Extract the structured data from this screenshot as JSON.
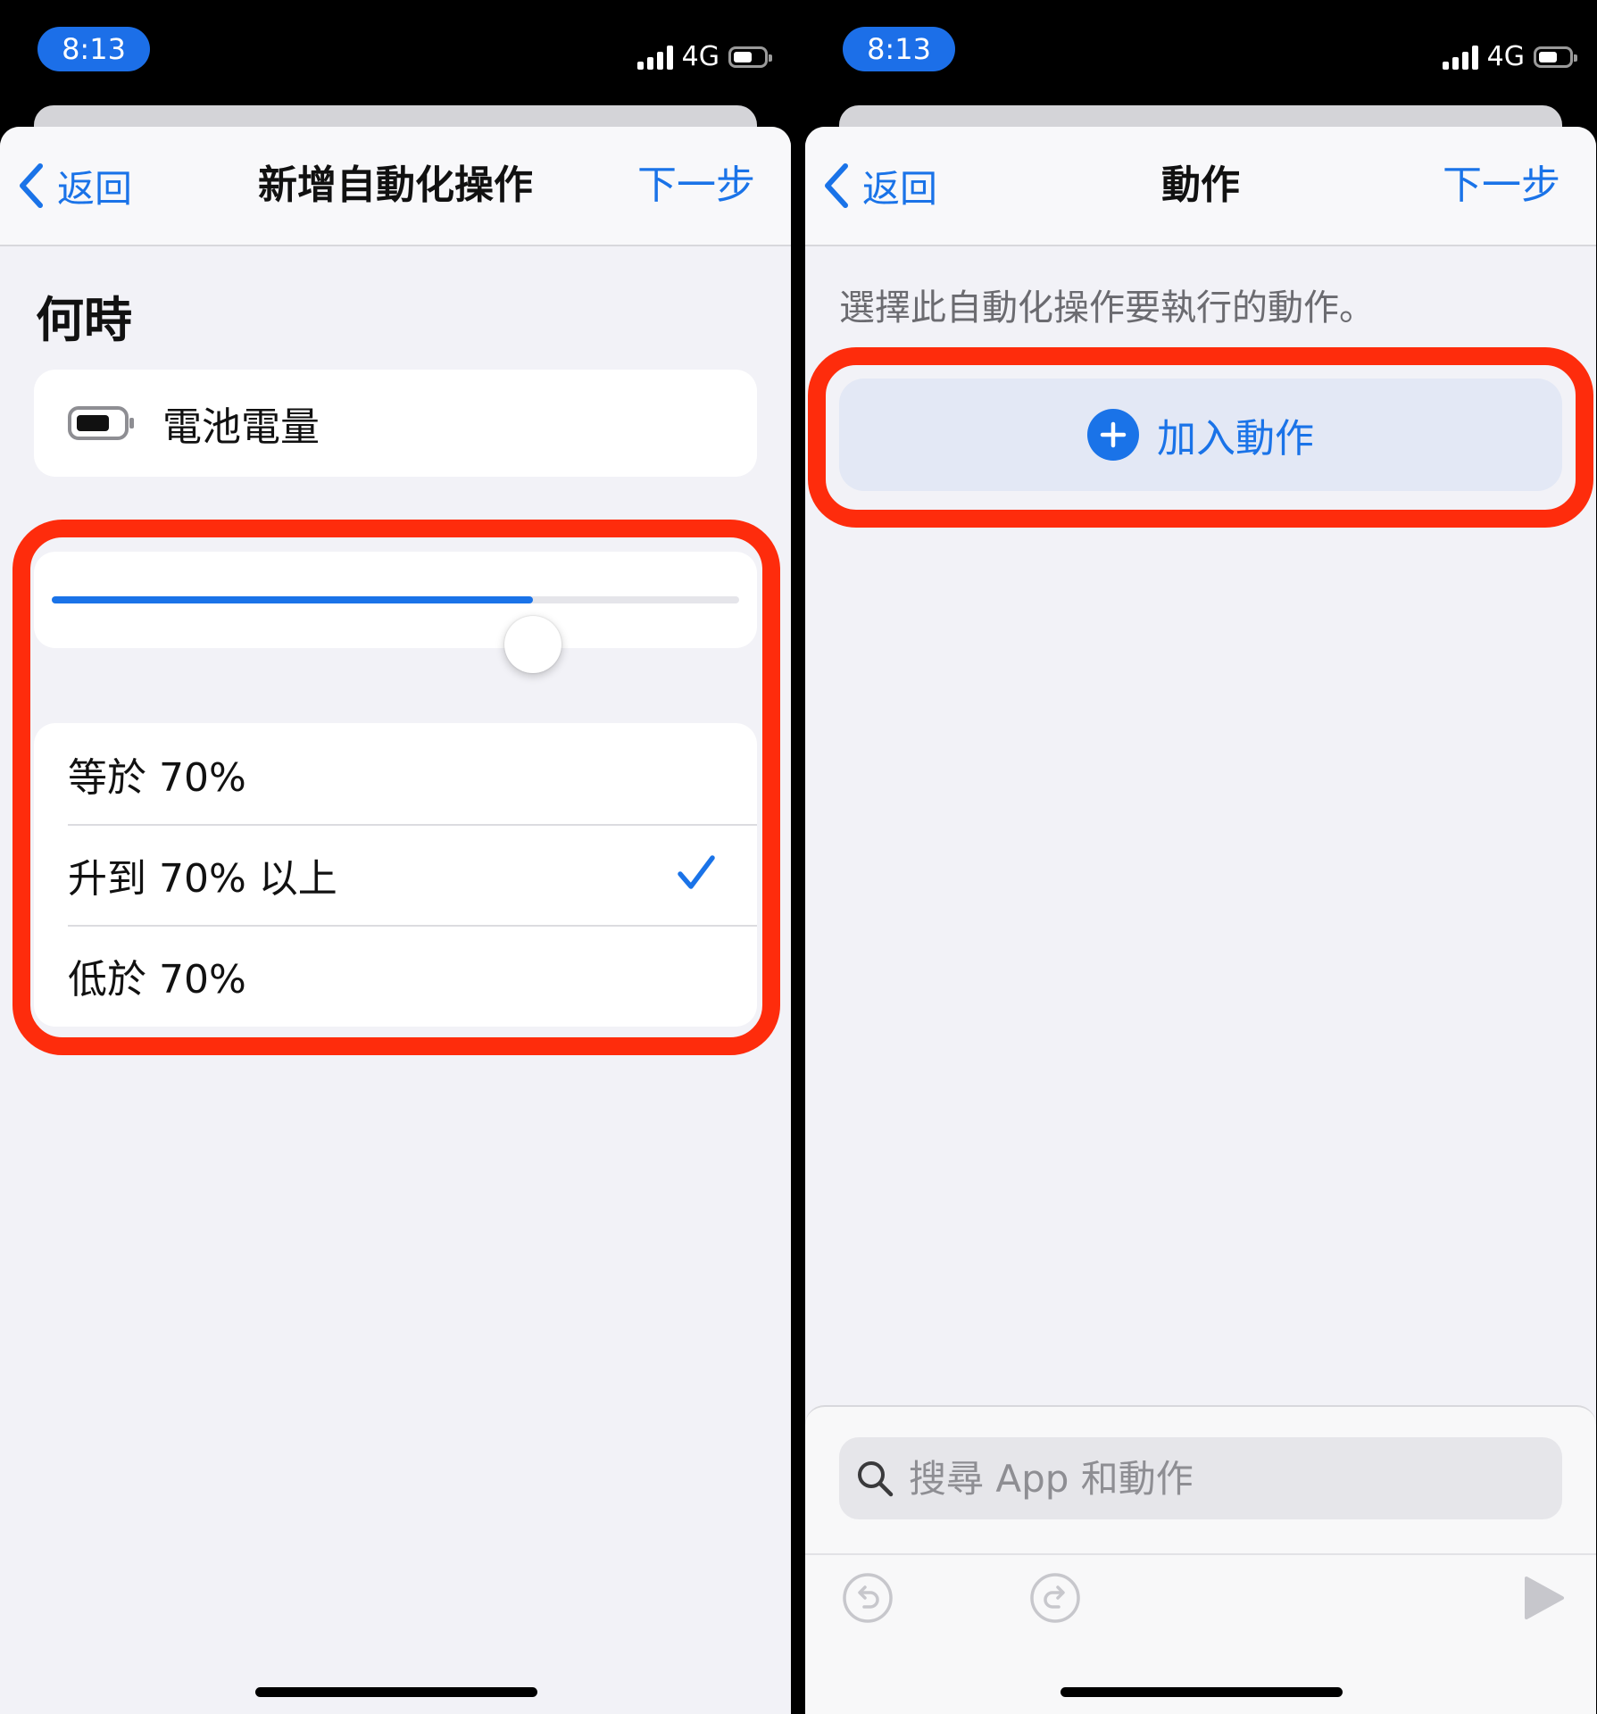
{
  "left_screen": {
    "status": {
      "time": "8:13",
      "network": "4G"
    },
    "nav": {
      "back_label": "返回",
      "title": "新增自動化操作",
      "next_label": "下一步"
    },
    "section_title": "何時",
    "trigger": {
      "icon": "battery-icon",
      "label": "電池電量"
    },
    "slider": {
      "value_percent": 70
    },
    "options": [
      {
        "label": "等於 70%",
        "selected": false
      },
      {
        "label": "升到 70% 以上",
        "selected": true
      },
      {
        "label": "低於 70%",
        "selected": false
      }
    ]
  },
  "right_screen": {
    "status": {
      "time": "8:13",
      "network": "4G"
    },
    "nav": {
      "back_label": "返回",
      "title": "動作",
      "next_label": "下一步"
    },
    "subtitle": "選擇此自動化操作要執行的動作。",
    "add_action_label": "加入動作",
    "search": {
      "placeholder": "搜尋 App 和動作",
      "value": ""
    },
    "toolbar_icons": [
      "undo-icon",
      "redo-icon",
      "play-icon"
    ]
  },
  "colors": {
    "accent": "#1a73e8",
    "highlight": "#fe2c0c",
    "time_pill": "#1c6fe8",
    "background": "#f2f2f7"
  }
}
